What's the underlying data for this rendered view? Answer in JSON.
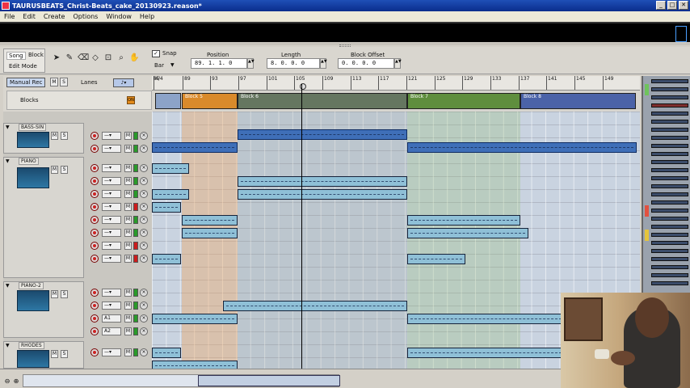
{
  "window": {
    "title": "TAURUSBEATS_Christ-Beats_cake_20130923.reason*",
    "buttons": [
      "_",
      "□",
      "✕"
    ]
  },
  "menu": [
    "File",
    "Edit",
    "Create",
    "Options",
    "Window",
    "Help"
  ],
  "toolbar": {
    "mode_song": "Song",
    "mode_block": "Block",
    "edit_mode": "Edit Mode",
    "snap_label": "Snap",
    "snap_checked": "✓",
    "snap_value": "Bar",
    "position_label": "Position",
    "position_value": "89. 1. 1.   0",
    "length_label": "Length",
    "length_value": "8. 0. 0.   0",
    "block_offset_label": "Block Offset",
    "block_offset_value": "0. 0. 0.   0"
  },
  "left": {
    "manual_rec": "Manual Rec",
    "m_btn": "M",
    "s_btn": "S",
    "lanes_label": "Lanes",
    "blocks_label": "Blocks",
    "blocks_on": "ON",
    "tracks": [
      {
        "name": "BASS-SIN"
      },
      {
        "name": "PIANO"
      },
      {
        "name": "PIANO-2"
      },
      {
        "name": "RHODES"
      }
    ],
    "lane_m": "M",
    "lane_x": "×",
    "lane_labels": [
      "A1",
      "A2"
    ]
  },
  "ruler": {
    "time_signature": "4/4",
    "ticks": [
      "85",
      "89",
      "93",
      "97",
      "101",
      "105",
      "109",
      "113",
      "117",
      "121",
      "125",
      "129",
      "133",
      "137",
      "141",
      "145",
      "149"
    ]
  },
  "blocks": [
    {
      "name": "Block 5",
      "color": "#d98a2b"
    },
    {
      "name": "Block 6",
      "color": "#657660"
    },
    {
      "name": "Block 7",
      "color": "#5f8e3e"
    },
    {
      "name": "Block 8",
      "color": "#4b63a8"
    }
  ],
  "colors": {
    "title_bar": "#0a2d8c",
    "clip_light": "#8fc0d7",
    "clip_dark": "#3f6fb8",
    "grid_bg": "#c9d3e0",
    "record_red": "#cc1c1c"
  }
}
